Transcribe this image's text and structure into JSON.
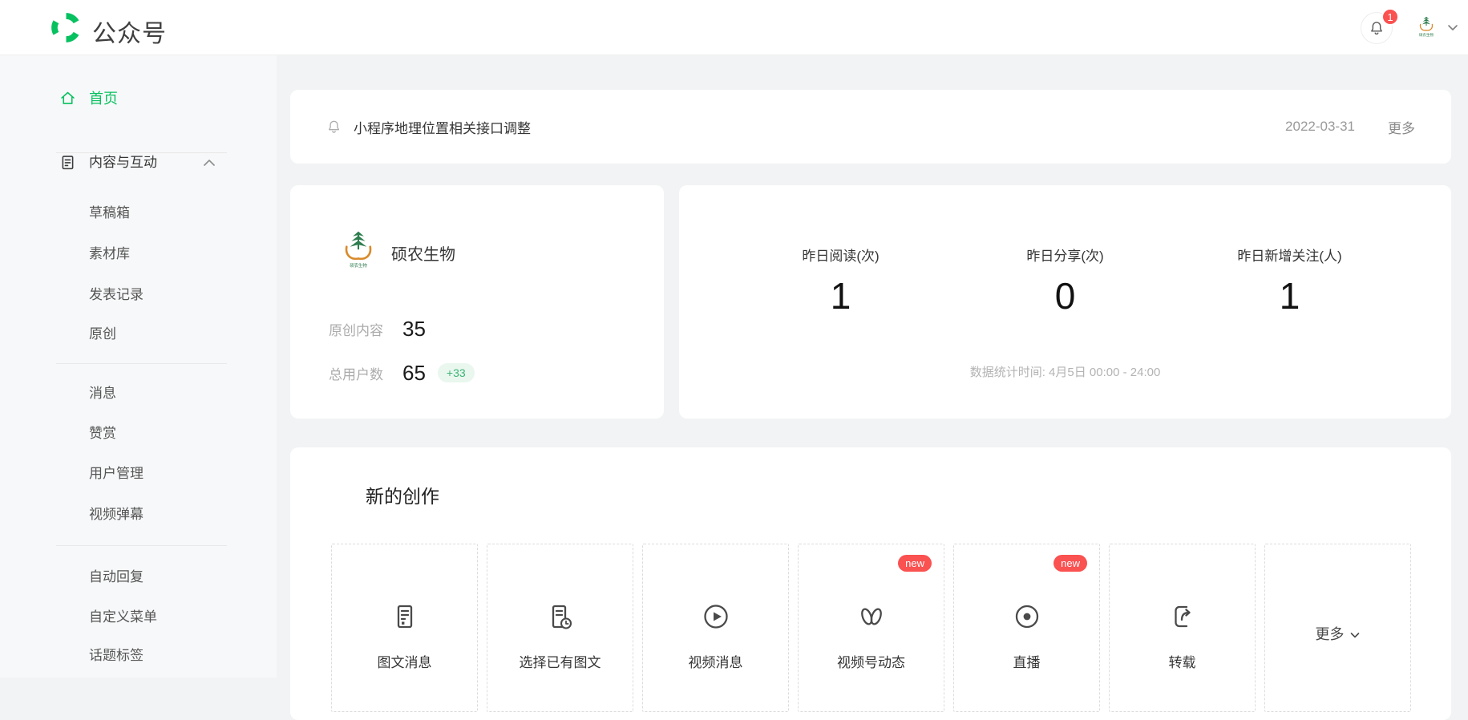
{
  "header": {
    "title": "公众号",
    "notification_count": "1"
  },
  "sidebar": {
    "home": "首页",
    "section": "内容与互动",
    "group1": [
      "草稿箱",
      "素材库",
      "发表记录",
      "原创"
    ],
    "group2": [
      "消息",
      "赞赏",
      "用户管理",
      "视频弹幕"
    ],
    "group3": [
      "自动回复",
      "自定义菜单",
      "话题标签"
    ]
  },
  "notice": {
    "text": "小程序地理位置相关接口调整",
    "date": "2022-03-31",
    "more": "更多"
  },
  "account": {
    "name": "硕农生物",
    "caption": "硕农生物",
    "rows": [
      {
        "label": "原创内容",
        "value": "35"
      },
      {
        "label": "总用户数",
        "value": "65",
        "badge": "+33"
      }
    ]
  },
  "daily": {
    "stats": [
      {
        "label": "昨日阅读(次)",
        "value": "1"
      },
      {
        "label": "昨日分享(次)",
        "value": "0"
      },
      {
        "label": "昨日新增关注(人)",
        "value": "1"
      }
    ],
    "note": "数据统计时间: 4月5日 00:00 - 24:00"
  },
  "creation": {
    "title": "新的创作",
    "tiles": [
      {
        "label": "图文消息"
      },
      {
        "label": "选择已有图文"
      },
      {
        "label": "视频消息"
      },
      {
        "label": "视频号动态",
        "badge": "new"
      },
      {
        "label": "直播",
        "badge": "new"
      },
      {
        "label": "转载"
      }
    ],
    "more": "更多"
  },
  "colors": {
    "accent": "#07c160",
    "badge_red": "#fa5151",
    "growth_green": "#3eb575"
  }
}
